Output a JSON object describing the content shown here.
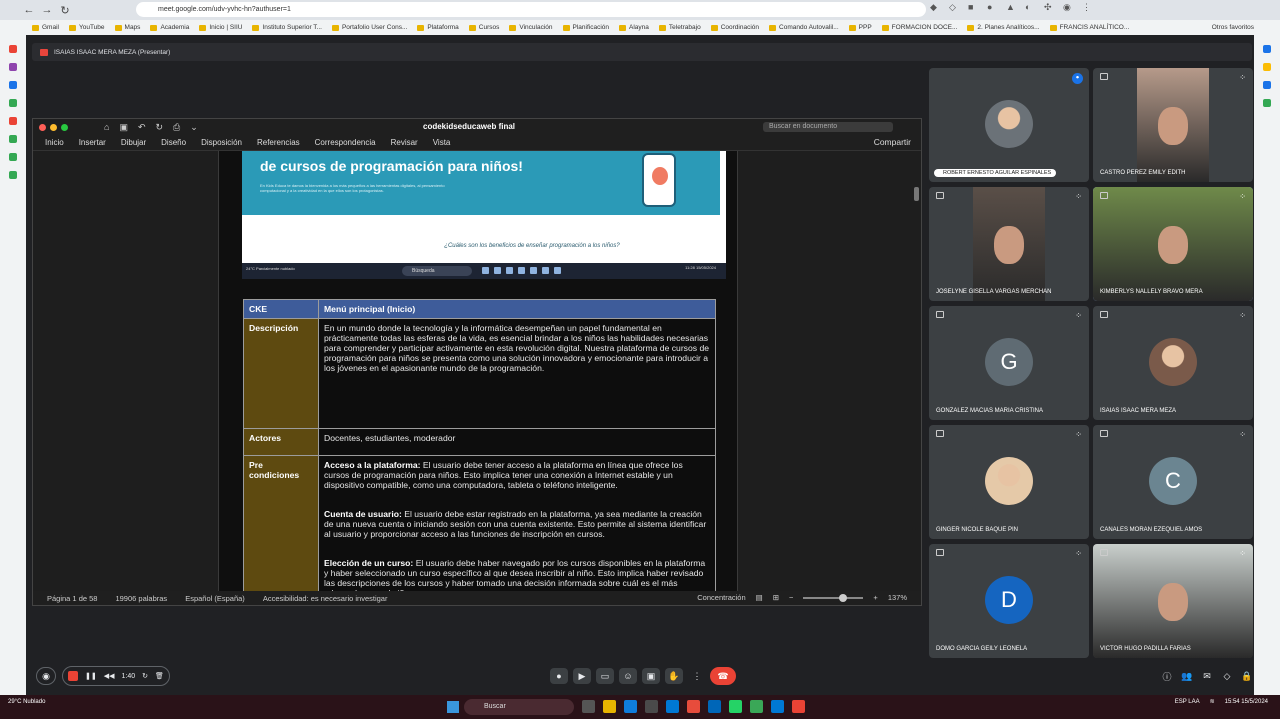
{
  "browser": {
    "url": "meet.google.com/udv-yvhc-hn?authuser=1",
    "bookmarks": [
      "Gmail",
      "YouTube",
      "Maps",
      "Academia",
      "Inicio | SIIU",
      "Instituto Superior T...",
      "Portafolio User Cons...",
      "Plataforma",
      "Cursos",
      "Vinculación",
      "Planificación",
      "Alayna",
      "Teletrabajo",
      "Coordinación",
      "Comando Autovalil...",
      "PPP",
      "FORMACION DOCE...",
      "2. Planes Analíticos...",
      "FRANCIS ANALÍTICO..."
    ],
    "other_bookmarks": "Otros favoritos"
  },
  "meet": {
    "presenter_label": "ISAIAS ISAAC MERA MEZA (Presentar)",
    "recording_time": "1:40"
  },
  "word": {
    "doc_title": "codekidseducaweb final",
    "search_placeholder": "Buscar en documento",
    "ribbon_tabs": [
      "Inicio",
      "Insertar",
      "Dibujar",
      "Diseño",
      "Disposición",
      "Referencias",
      "Correspondencia",
      "Revisar",
      "Vista"
    ],
    "share_label": "Compartir",
    "status": {
      "page": "Página 1 de 58",
      "words": "19906 palabras",
      "language": "Español (España)",
      "accessibility": "Accesibilidad: es necesario investigar",
      "focus": "Concentración",
      "zoom": "137%"
    }
  },
  "embed": {
    "hero_title": "de cursos de programación para niños!",
    "hero_text": "En Kids Educa te damos la bienvenida a los más pequeños a las herramientas digitales, al pensamiento computacional y a la creatividad en la que ellos son los protagonistas.",
    "subheading": "¿Cuáles son los beneficios de enseñar programación a los niños?",
    "taskbar_search": "Búsqueda",
    "taskbar_clock": "11:28 15/05/2024",
    "weather": "24°C Parcialmente nublado"
  },
  "table": {
    "header": {
      "key": "CKE",
      "value": "Menú principal (Inicio)"
    },
    "descripcion": {
      "key": "Descripción",
      "value": "En un mundo donde la tecnología y la informática desempeñan un papel fundamental en prácticamente todas las esferas de la vida, es esencial brindar a los niños las habilidades necesarias para comprender y participar activamente en esta revolución digital. Nuestra plataforma de cursos de programación para niños se presenta como una solución innovadora y emocionante para introducir a los jóvenes en el apasionante mundo de la programación."
    },
    "actores": {
      "key": "Actores",
      "value": "Docentes, estudiantes, moderador"
    },
    "precondiciones": {
      "key": "Pre condiciones",
      "items": [
        {
          "title": "Acceso a la plataforma:",
          "text": " El usuario debe tener acceso a la plataforma en línea que ofrece los cursos de programación para niños. Esto implica tener una conexión a Internet estable y un dispositivo compatible, como una computadora, tableta o teléfono inteligente."
        },
        {
          "title": "Cuenta de usuario:",
          "text": " El usuario debe estar registrado en la plataforma, ya sea mediante la creación de una nueva cuenta o iniciando sesión con una cuenta existente. Esto permite al sistema identificar al usuario y proporcionar acceso a las funciones de inscripción en cursos."
        },
        {
          "title": "Elección de un curso:",
          "text": " El usuario debe haber navegado por los cursos disponibles en la plataforma y haber seleccionado un curso específico al que desea inscribir al niño. Esto implica haber revisado las descripciones de los cursos y haber tomado una decisión informada sobre cuál es el más adecuado para el niño."
        }
      ]
    }
  },
  "participants": [
    {
      "name": "ROBERT ERNESTO AGUILAR ESPINALES",
      "kind": "photo",
      "color": "#6b7278"
    },
    {
      "name": "CASTRO PEREZ EMILY EDITH",
      "kind": "video",
      "color": "#b69a8a"
    },
    {
      "name": "JOSELYNE GISELLA VARGAS MERCHAN",
      "kind": "video",
      "color": "#5a4f48"
    },
    {
      "name": "KIMBERLYS NALLELY BRAVO MERA",
      "kind": "video",
      "color": "#6f8a4a"
    },
    {
      "name": "GONZALEZ MACIAS MARIA CRISTINA",
      "kind": "letter",
      "letter": "G",
      "color": "#5f6b73"
    },
    {
      "name": "ISAIAS ISAAC MERA MEZA",
      "kind": "photo",
      "color": "#7a5a4a"
    },
    {
      "name": "GINGER NICOLE BAQUE PIN",
      "kind": "photo",
      "color": "#e5c9a8"
    },
    {
      "name": "CANALES MORAN EZEQUIEL AMOS",
      "kind": "letter",
      "letter": "C",
      "color": "#6b8591"
    },
    {
      "name": "DOMO GARCIA GEILY LEONELA",
      "kind": "letter",
      "letter": "D",
      "color": "#1565c0"
    },
    {
      "name": "VICTOR HUGO PADILLA FARIAS",
      "kind": "video",
      "color": "#c9cfcc"
    }
  ],
  "taskbar": {
    "weather": "29°C Nublado",
    "search": "Buscar",
    "tray_lang": "ESP LAA",
    "clock": "15:54 15/5/2024"
  },
  "colors": {
    "table_key_bg": "#5e4a10",
    "table_header_bg": "#3e5c9a",
    "end_call": "#ea4335",
    "hero_bg": "#2b9ab7"
  }
}
